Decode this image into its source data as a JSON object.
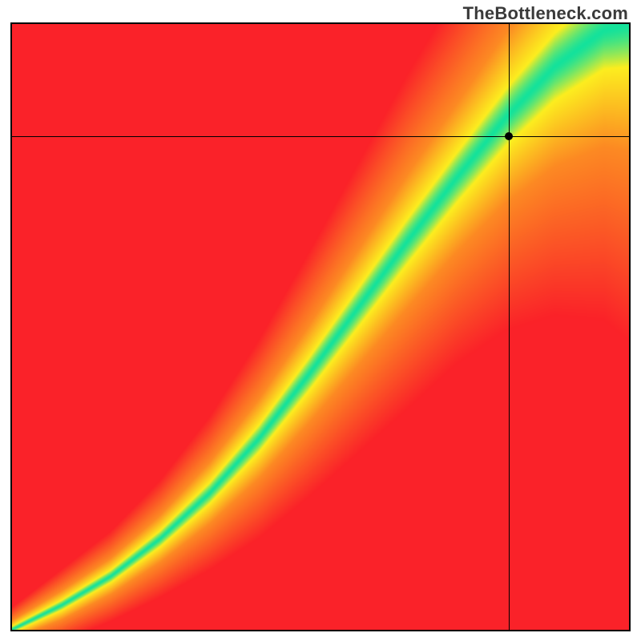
{
  "attribution": "TheBottleneck.com",
  "palette": {
    "green": "#14e29c",
    "yellow": "#fcee1f",
    "orange": "#fd8a23",
    "red": "#fa2229"
  },
  "crosshair": {
    "x_frac": 0.805,
    "y_frac": 0.185
  },
  "ridge": {
    "comment": "Approximate centerline of the green ridge and its half-width (in output-normalized units). x and y are fractions across the full [0,1] plot area; half_width is the green band half-thickness.",
    "points": [
      {
        "x": 0.0,
        "y": 0.0,
        "half_width": 0.005
      },
      {
        "x": 0.08,
        "y": 0.04,
        "half_width": 0.008
      },
      {
        "x": 0.16,
        "y": 0.088,
        "half_width": 0.01
      },
      {
        "x": 0.24,
        "y": 0.15,
        "half_width": 0.013
      },
      {
        "x": 0.32,
        "y": 0.225,
        "half_width": 0.017
      },
      {
        "x": 0.4,
        "y": 0.315,
        "half_width": 0.022
      },
      {
        "x": 0.48,
        "y": 0.42,
        "half_width": 0.027
      },
      {
        "x": 0.56,
        "y": 0.53,
        "half_width": 0.032
      },
      {
        "x": 0.64,
        "y": 0.64,
        "half_width": 0.037
      },
      {
        "x": 0.72,
        "y": 0.745,
        "half_width": 0.041
      },
      {
        "x": 0.8,
        "y": 0.845,
        "half_width": 0.047
      },
      {
        "x": 0.88,
        "y": 0.93,
        "half_width": 0.055
      },
      {
        "x": 0.96,
        "y": 0.99,
        "half_width": 0.064
      },
      {
        "x": 1.0,
        "y": 1.0,
        "half_width": 0.07
      }
    ],
    "yellow_factor": 3.0,
    "orange_factor": 7.5
  },
  "chart_data": {
    "type": "heatmap",
    "title": "",
    "xlabel": "",
    "ylabel": "",
    "x_range": [
      0,
      1
    ],
    "y_range": [
      0,
      1
    ],
    "description": "Bottleneck heatmap. Green diagonal ridge = balanced configurations; hue shifts through yellow/orange to red with increasing distance from ridge. Ridge curves from bottom-left corner to top-right corner with slight S-shape. Overlaid crosshair marks a specific (x≈0.805, y≈0.815 from bottom) configuration just below the green band.",
    "crosshair": {
      "x": 0.805,
      "y": 0.815
    },
    "ridge_center": [
      {
        "x": 0.0,
        "y": 0.0
      },
      {
        "x": 0.08,
        "y": 0.04
      },
      {
        "x": 0.16,
        "y": 0.088
      },
      {
        "x": 0.24,
        "y": 0.15
      },
      {
        "x": 0.32,
        "y": 0.225
      },
      {
        "x": 0.4,
        "y": 0.315
      },
      {
        "x": 0.48,
        "y": 0.42
      },
      {
        "x": 0.56,
        "y": 0.53
      },
      {
        "x": 0.64,
        "y": 0.64
      },
      {
        "x": 0.72,
        "y": 0.745
      },
      {
        "x": 0.8,
        "y": 0.845
      },
      {
        "x": 0.88,
        "y": 0.93
      },
      {
        "x": 0.96,
        "y": 0.99
      },
      {
        "x": 1.0,
        "y": 1.0
      }
    ]
  }
}
